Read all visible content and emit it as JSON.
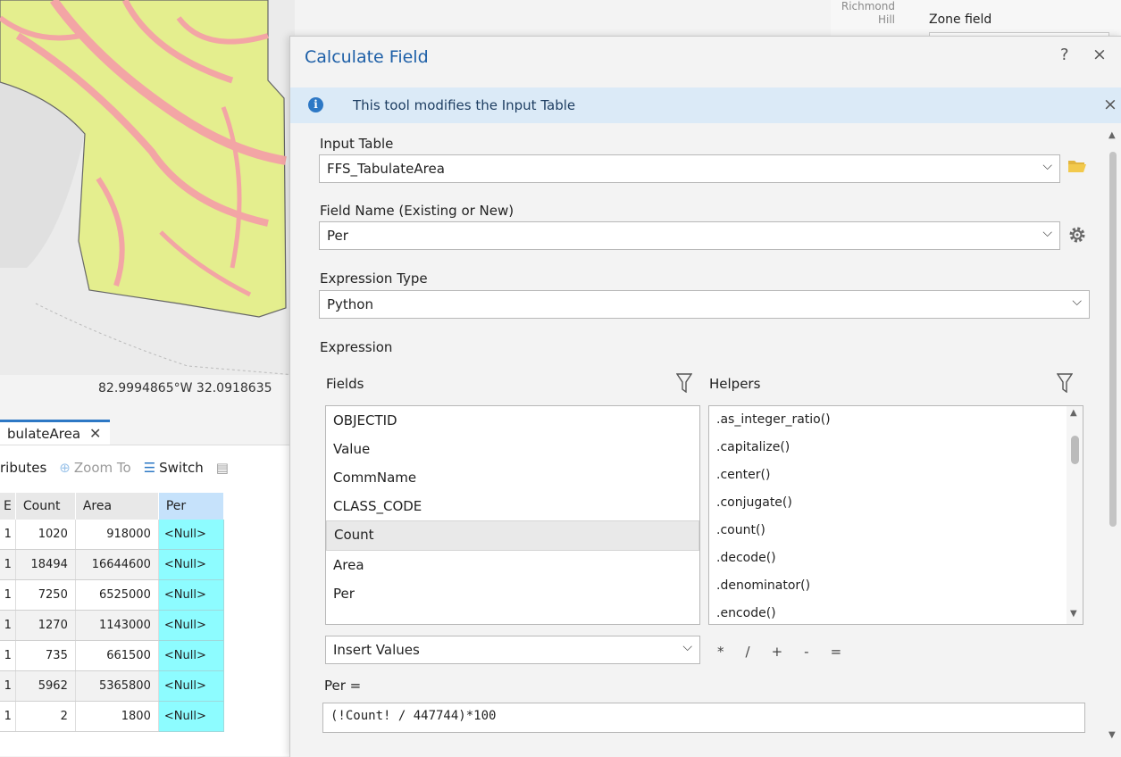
{
  "map": {
    "coordinates": "82.9994865°W 32.0918635",
    "place_label": "Richmond Hill",
    "zone_field_label": "Zone field"
  },
  "attribute_table": {
    "tab_label": "bulateArea",
    "toolbar": {
      "attributes_label": "ributes",
      "zoom_to_label": "Zoom To",
      "switch_label": "Switch"
    },
    "columns": [
      "E",
      "Count",
      "Area",
      "Per"
    ],
    "rows": [
      {
        "e": "1",
        "count": "1020",
        "area": "918000",
        "per": "<Null>"
      },
      {
        "e": "1",
        "count": "18494",
        "area": "16644600",
        "per": "<Null>"
      },
      {
        "e": "1",
        "count": "7250",
        "area": "6525000",
        "per": "<Null>"
      },
      {
        "e": "1",
        "count": "1270",
        "area": "1143000",
        "per": "<Null>"
      },
      {
        "e": "1",
        "count": "735",
        "area": "661500",
        "per": "<Null>"
      },
      {
        "e": "1",
        "count": "5962",
        "area": "5365800",
        "per": "<Null>"
      },
      {
        "e": "1",
        "count": "2",
        "area": "1800",
        "per": "<Null>"
      }
    ]
  },
  "dialog": {
    "title": "Calculate Field",
    "help": "?",
    "close": "×",
    "info_message": "This tool modifies the Input Table",
    "input_table_label": "Input Table",
    "input_table_value": "FFS_TabulateArea",
    "field_name_label": "Field Name (Existing or New)",
    "field_name_value": "Per",
    "expression_type_label": "Expression Type",
    "expression_type_value": "Python",
    "expression_label": "Expression",
    "fields_label": "Fields",
    "helpers_label": "Helpers",
    "fields": [
      "OBJECTID",
      "Value",
      "CommName",
      "CLASS_CODE",
      "Count",
      "Area",
      "Per"
    ],
    "selected_field": "Count",
    "helpers": [
      ".as_integer_ratio()",
      ".capitalize()",
      ".center()",
      ".conjugate()",
      ".count()",
      ".decode()",
      ".denominator()",
      ".encode()"
    ],
    "insert_values_label": "Insert Values",
    "operators": [
      "*",
      "/",
      "+",
      "-",
      "="
    ],
    "expression_prefix": "Per =",
    "expression_value": "(!Count! / 447744)*100"
  },
  "colors": {
    "accent": "#2d78c5",
    "title": "#1d5fa7",
    "info_bar": "#dbeaf7",
    "null_cell": "#8dfcff",
    "map_fill": "#e4ee8e",
    "map_pink": "#f3a5a5"
  }
}
